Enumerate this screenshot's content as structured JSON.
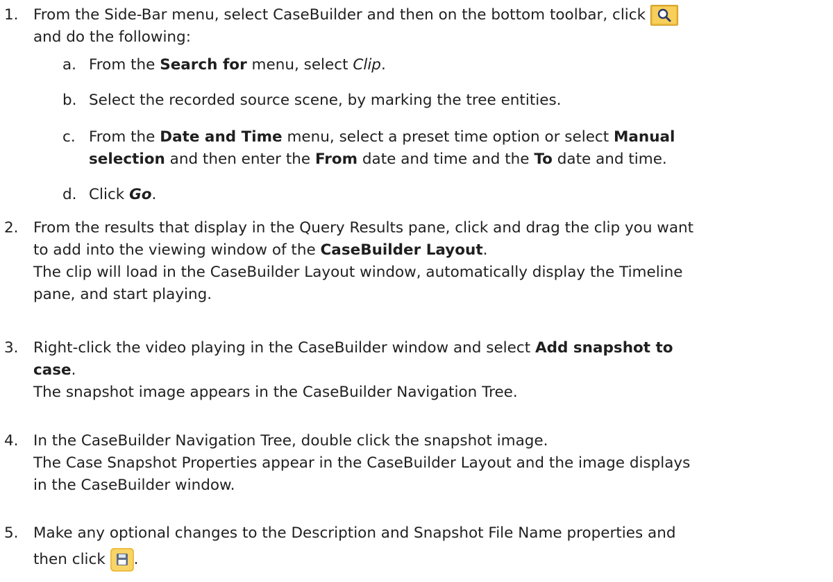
{
  "colors": {
    "text": "#1f1f1f",
    "search_icon_bg": "#f5c542",
    "search_icon_border": "#c8961d",
    "save_icon_bg": "#f6c94c"
  },
  "icons": {
    "search": "search-icon",
    "save": "save-icon"
  },
  "steps": [
    {
      "number": "1.",
      "l1_a": "From the Side-Bar menu, select CaseBuilder and then on the bottom toolbar, click ",
      "l2": "and do the following:",
      "substeps": [
        {
          "label": "a.",
          "t1": "From the ",
          "b1": "Search for",
          "t2": " menu, select ",
          "i1": "Clip",
          "t3": "."
        },
        {
          "label": "b.",
          "t1": "Select the recorded source scene, by marking the tree entities."
        },
        {
          "label": "c.",
          "t1": "From the ",
          "b1": "Date and Time",
          "t2": " menu, select a preset time option or select ",
          "b2": "Manual",
          "b3": "selection",
          "t4": " and then enter the ",
          "b4": "From",
          "t5": " date and time and the ",
          "b5": "To",
          "t6": " date and time."
        },
        {
          "label": "d.",
          "t1": "Click ",
          "bi1": "Go",
          "t2": "."
        }
      ]
    },
    {
      "number": "2.",
      "l1": "From the results that display in the Query Results pane, click and drag the clip you want",
      "l2_a": "to add into the viewing window of the ",
      "l2_b": "CaseBuilder Layout",
      "l2_c": ".",
      "l3": "The clip will load in the CaseBuilder Layout window, automatically display the Timeline",
      "l4": "pane, and start playing."
    },
    {
      "number": "3.",
      "l1_a": "Right-click the video playing in the CaseBuilder window and select ",
      "l1_b": "Add snapshot to",
      "l2_b": "case",
      "l2_c": ".",
      "l3": "The snapshot image appears in the CaseBuilder Navigation Tree."
    },
    {
      "number": "4.",
      "l1": "In the CaseBuilder Navigation Tree, double click the snapshot image.",
      "l2": "The Case Snapshot Properties appear in the CaseBuilder Layout and the image displays",
      "l3": "in the CaseBuilder window."
    },
    {
      "number": "5.",
      "l1": " Make any optional changes to the Description and Snapshot File Name properties and",
      "l2_a": "then click ",
      "l2_b": "."
    }
  ]
}
